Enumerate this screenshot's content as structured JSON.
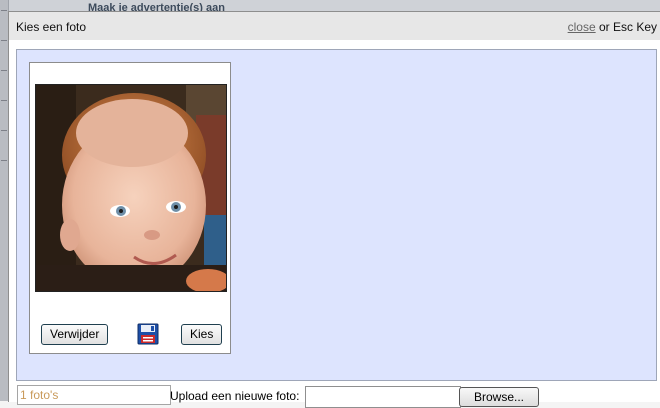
{
  "backdrop": {
    "title": "Maak je advertentie(s) aan"
  },
  "modal": {
    "title": "Kies een foto",
    "close_link": "close",
    "close_hint": " or Esc Key"
  },
  "photo": {
    "delete_label": "Verwijder",
    "select_label": "Kies",
    "save_icon": "floppy-disk-icon"
  },
  "footer": {
    "count": "1 foto's",
    "upload_label": "Upload een nieuwe foto:",
    "file_value": "",
    "browse_label": "Browse..."
  },
  "colors": {
    "gallery_bg": "#dde4fe",
    "header_bg": "#e7e7e7",
    "count_text": "#c99a5a"
  }
}
